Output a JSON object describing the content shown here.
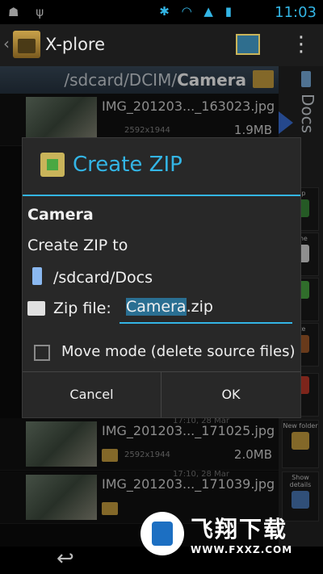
{
  "statusbar": {
    "left_icons": "☗ ψ",
    "right_icons": "✱ ◠ ▲ ▮",
    "time": "11:03"
  },
  "actionbar": {
    "back_glyph": "‹",
    "title": "X-plore",
    "menu_glyph": "⋮"
  },
  "path": {
    "prefix": "/sdcard/DCIM/",
    "folder": "Camera"
  },
  "right_panel": {
    "label": "Docs",
    "buttons": [
      {
        "label": "Zip"
      },
      {
        "label": "ame"
      },
      {
        "label": ""
      },
      {
        "label": "ete"
      },
      {
        "label": ""
      },
      {
        "label": "New folder"
      },
      {
        "label": "Show details"
      }
    ]
  },
  "files": [
    {
      "name": "IMG_201203..._163023.jpg",
      "size": "1.9MB",
      "resolution": "2592x1944",
      "date": ""
    },
    {
      "name": "IMG_201203..._171025.jpg",
      "size": "2.0MB",
      "resolution": "2592x1944",
      "date": "17:10, 28 Mar"
    },
    {
      "name": "IMG_201203..._171039.jpg",
      "size": "",
      "resolution": "",
      "date": "17:10, 28 Mar"
    }
  ],
  "dialog": {
    "title": "Create ZIP",
    "folder_name": "Camera",
    "create_label": "Create ZIP to",
    "destination": "/sdcard/Docs",
    "zip_label": "Zip file:",
    "zip_name_base": "Camera",
    "zip_ext": ".zip",
    "move_mode_label": "Move mode (delete source files)",
    "move_mode_checked": false,
    "cancel_label": "Cancel",
    "ok_label": "OK"
  },
  "navbar": {
    "back_glyph": "↩"
  },
  "watermark": {
    "cn": "飞翔下载",
    "url": "WWW.FXXZ.COM"
  },
  "colors": {
    "accent": "#33b5e5",
    "background": "#0b0b0b",
    "dialog": "#282828"
  }
}
